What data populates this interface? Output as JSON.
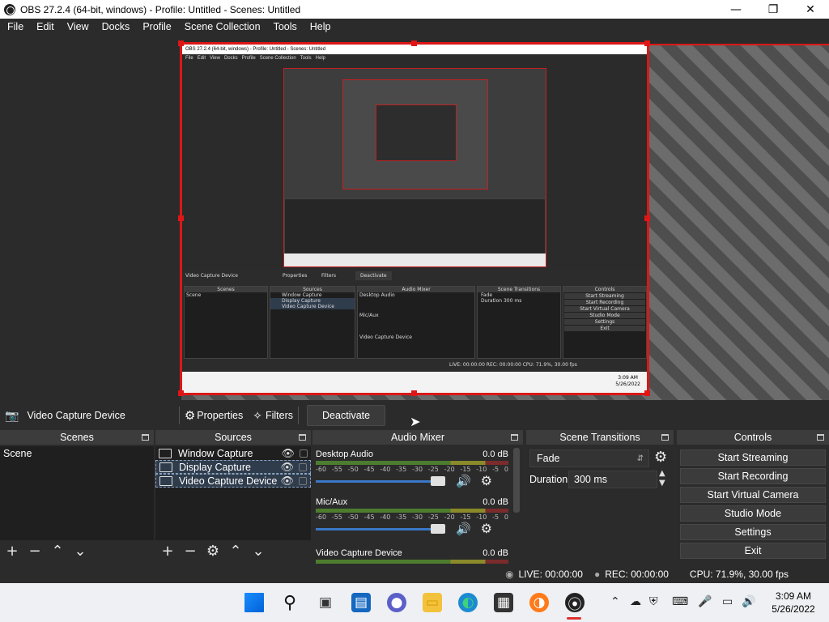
{
  "window": {
    "title": "OBS 27.2.4 (64-bit, windows) - Profile: Untitled - Scenes: Untitled",
    "minimize": "—",
    "maximize": "❐",
    "close": "✕"
  },
  "menu": [
    "File",
    "Edit",
    "View",
    "Docks",
    "Profile",
    "Scene Collection",
    "Tools",
    "Help"
  ],
  "context_bar": {
    "source_name": "Video Capture Device",
    "properties_label": "Properties",
    "filters_label": "Filters",
    "deactivate_label": "Deactivate"
  },
  "docks": {
    "scenes": {
      "title": "Scenes",
      "items": [
        "Scene"
      ]
    },
    "sources": {
      "title": "Sources",
      "items": [
        {
          "name": "Window Capture",
          "selected": false
        },
        {
          "name": "Display Capture",
          "selected": true
        },
        {
          "name": "Video Capture Device",
          "selected": true
        }
      ]
    },
    "audio_mixer": {
      "title": "Audio Mixer",
      "scale": [
        "-60",
        "-55",
        "-50",
        "-45",
        "-40",
        "-35",
        "-30",
        "-25",
        "-20",
        "-15",
        "-10",
        "-5",
        "0"
      ],
      "channels": [
        {
          "name": "Desktop Audio",
          "level": "0.0 dB"
        },
        {
          "name": "Mic/Aux",
          "level": "0.0 dB"
        },
        {
          "name": "Video Capture Device",
          "level": "0.0 dB"
        }
      ]
    },
    "scene_transitions": {
      "title": "Scene Transitions",
      "transition": "Fade",
      "duration_label": "Duration",
      "duration_value": "300 ms"
    },
    "controls": {
      "title": "Controls",
      "buttons": [
        "Start Streaming",
        "Start Recording",
        "Start Virtual Camera",
        "Studio Mode",
        "Settings",
        "Exit"
      ]
    }
  },
  "status": {
    "live": "LIVE: 00:00:00",
    "rec": "REC: 00:00:00",
    "cpu": "CPU: 71.9%, 30.00 fps"
  },
  "inner_preview": {
    "title": "OBS 27.2.4 (64-bit, windows) - Profile: Untitled - Scenes: Untitled",
    "menu": [
      "File",
      "Edit",
      "View",
      "Docks",
      "Profile",
      "Scene Collection",
      "Tools",
      "Help"
    ],
    "source_name": "Video Capture Device",
    "properties_label": "Properties",
    "filters_label": "Filters",
    "deactivate_label": "Deactivate",
    "scenes_title": "Scenes",
    "sources_title": "Sources",
    "mixer_title": "Audio Mixer",
    "transitions_title": "Scene Transitions",
    "controls_title": "Controls",
    "scene_item": "Scene",
    "source_items": [
      "Window Capture",
      "Display Capture",
      "Video Capture Device"
    ],
    "channels": [
      "Desktop Audio",
      "Mic/Aux",
      "Video Capture Device"
    ],
    "transition": "Fade",
    "duration_label": "Duration",
    "duration_value": "300 ms",
    "control_buttons": [
      "Start Streaming",
      "Start Recording",
      "Start Virtual Camera",
      "Studio Mode",
      "Settings",
      "Exit"
    ],
    "status": "LIVE: 00:00:00   REC: 00:00:00   CPU: 71.9%, 30.00 fps",
    "clock_time": "3:09 AM",
    "clock_date": "5/26/2022"
  },
  "taskbar": {
    "time": "3:09 AM",
    "date": "5/26/2022"
  },
  "colors": {
    "selection_red": "#e01616",
    "background": "#2b2b2b",
    "dock_title": "#3c3c3c",
    "meter_green": "#4c7c2e",
    "slider_blue": "#3a78c8"
  }
}
